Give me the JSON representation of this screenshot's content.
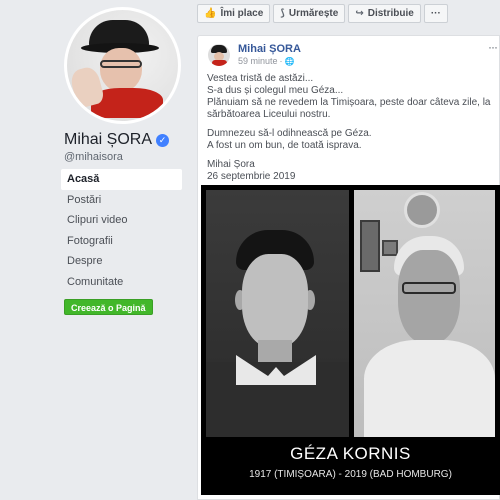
{
  "page": {
    "name": "Mihai ȘORA",
    "handle": "@mihaisora"
  },
  "nav": {
    "items": [
      {
        "label": "Acasă",
        "active": true
      },
      {
        "label": "Postări",
        "active": false
      },
      {
        "label": "Clipuri video",
        "active": false
      },
      {
        "label": "Fotografii",
        "active": false
      },
      {
        "label": "Despre",
        "active": false
      },
      {
        "label": "Comunitate",
        "active": false
      }
    ],
    "create_page": "Creează o Pagină"
  },
  "actions": {
    "like": "Îmi place",
    "follow": "Urmărește",
    "share": "Distribuie",
    "more": "···"
  },
  "post": {
    "author": "Mihai ȘORA",
    "time": "59 minute",
    "more": "···",
    "lines_1": [
      "Vestea tristă de astăzi...",
      "S-a dus și colegul meu Géza...",
      "Plănuiam să ne revedem la Timișoara, peste doar câteva zile, la",
      "sărbătoarea Liceului nostru."
    ],
    "lines_2": [
      "Dumnezeu să-l odihnească pe Géza.",
      "A fost un om bun, de toată isprava."
    ],
    "signature": "Mihai Șora",
    "date": "26 septembrie 2019"
  },
  "photo": {
    "name": "GÉZA KORNIS",
    "dates": "1917 (TIMIȘOARA) - 2019 (BAD HOMBURG)"
  },
  "colors": {
    "link": "#365899",
    "green": "#42b72a",
    "background": "#e9ebee",
    "verified": "#4080ff"
  }
}
